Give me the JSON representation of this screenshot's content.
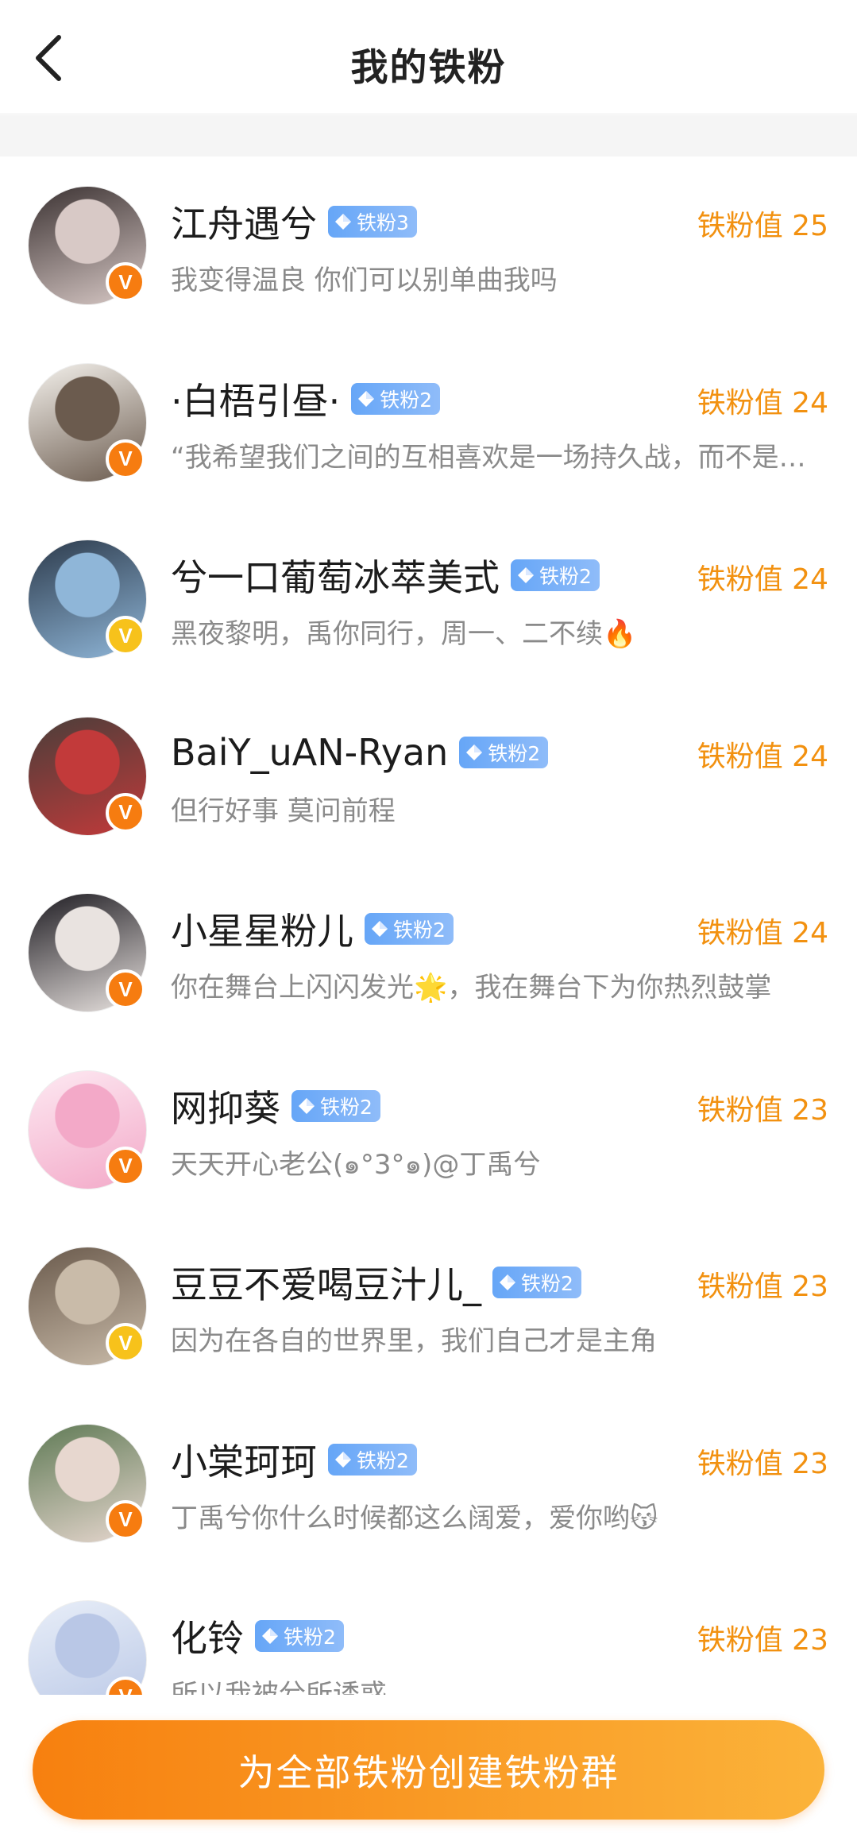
{
  "header": {
    "title": "我的铁粉",
    "back_icon": "chevron-left-icon"
  },
  "colors": {
    "accent": "#f29110",
    "cta_start": "#f7800f",
    "cta_end": "#fbb33a",
    "level_badge": "#66a6f7",
    "v_orange": "#f67c10",
    "v_yellow": "#f7c21b"
  },
  "fans": [
    {
      "name": "江舟遇兮",
      "level": "铁粉3",
      "value": "铁粉值 25",
      "signature": "我变得温良 你们可以别单曲我吗",
      "v_color": "orange",
      "avatar_bg": [
        "#3b3232",
        "#d8c9c6"
      ]
    },
    {
      "name": "·白梧引昼·",
      "level": "铁粉2",
      "value": "铁粉值 24",
      "signature": "“我希望我们之间的互相喜欢是一场持久战，而不是短暂的心动”",
      "v_color": "orange",
      "avatar_bg": [
        "#f4f1ec",
        "#6b5b4e"
      ]
    },
    {
      "name": "兮一口葡萄冰萃美式",
      "level": "铁粉2",
      "value": "铁粉值 24",
      "signature": "黑夜黎明，禹你同行，周一、二不续🔥",
      "v_color": "yellow",
      "avatar_bg": [
        "#2d3b4c",
        "#8fb6d8"
      ]
    },
    {
      "name": "BaiY_uAN-Ryan",
      "level": "铁粉2",
      "value": "铁粉值 24",
      "signature": "但行好事 莫问前程",
      "v_color": "orange",
      "avatar_bg": [
        "#4a3e3a",
        "#c23a3a"
      ]
    },
    {
      "name": "小星星粉儿",
      "level": "铁粉2",
      "value": "铁粉值 24",
      "signature": "你在舞台上闪闪发光🌟，我在舞台下为你热烈鼓掌",
      "v_color": "orange",
      "avatar_bg": [
        "#1e1c22",
        "#e9e3e0"
      ]
    },
    {
      "name": "网抑葵",
      "level": "铁粉2",
      "value": "铁粉值 23",
      "signature": "天天开心老公(๑°3°๑)@丁禹兮",
      "v_color": "orange",
      "avatar_bg": [
        "#fde9f2",
        "#f3a9c8"
      ]
    },
    {
      "name": "豆豆不爱喝豆汁儿_",
      "level": "铁粉2",
      "value": "铁粉值 23",
      "signature": "因为在各自的世界里，我们自己才是主角",
      "v_color": "yellow",
      "avatar_bg": [
        "#6a5a4c",
        "#c9bba9"
      ]
    },
    {
      "name": "小棠珂珂",
      "level": "铁粉2",
      "value": "铁粉值 23",
      "signature": "丁禹兮你什么时候都这么阔爱，爱你哟😽",
      "v_color": "orange",
      "avatar_bg": [
        "#5f7a55",
        "#e7d7cf"
      ]
    },
    {
      "name": "化铃",
      "level": "铁粉2",
      "value": "铁粉值 23",
      "signature": "所以我被兮所诱惑",
      "v_color": "orange",
      "avatar_bg": [
        "#e8eef8",
        "#b9c7e6"
      ]
    }
  ],
  "footer": {
    "cta_label": "为全部铁粉创建铁粉群"
  }
}
